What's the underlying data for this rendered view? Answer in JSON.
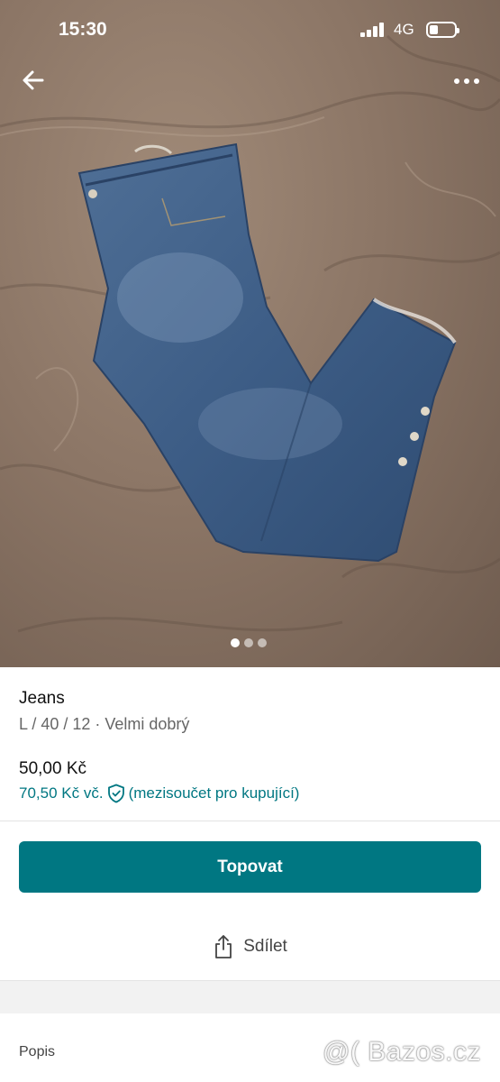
{
  "status_bar": {
    "time": "15:30",
    "network": "4G"
  },
  "header": {
    "back_icon": "arrow-left-icon",
    "more_icon": "more-dots-icon"
  },
  "gallery": {
    "photo_count": 3,
    "current_index": 1
  },
  "item": {
    "title": "Jeans",
    "details": "L / 40 / 12 · Velmi dobrý",
    "price": "50,00 Kč",
    "buyer_price": "70,50 Kč vč.",
    "buyer_price_note": "(mezisoučet pro kupující)"
  },
  "actions": {
    "promote_label": "Topovat",
    "share_label": "Sdílet"
  },
  "description": {
    "heading": "Popis"
  },
  "watermark": "@( Bazos.cz",
  "colors": {
    "accent": "#007782"
  }
}
